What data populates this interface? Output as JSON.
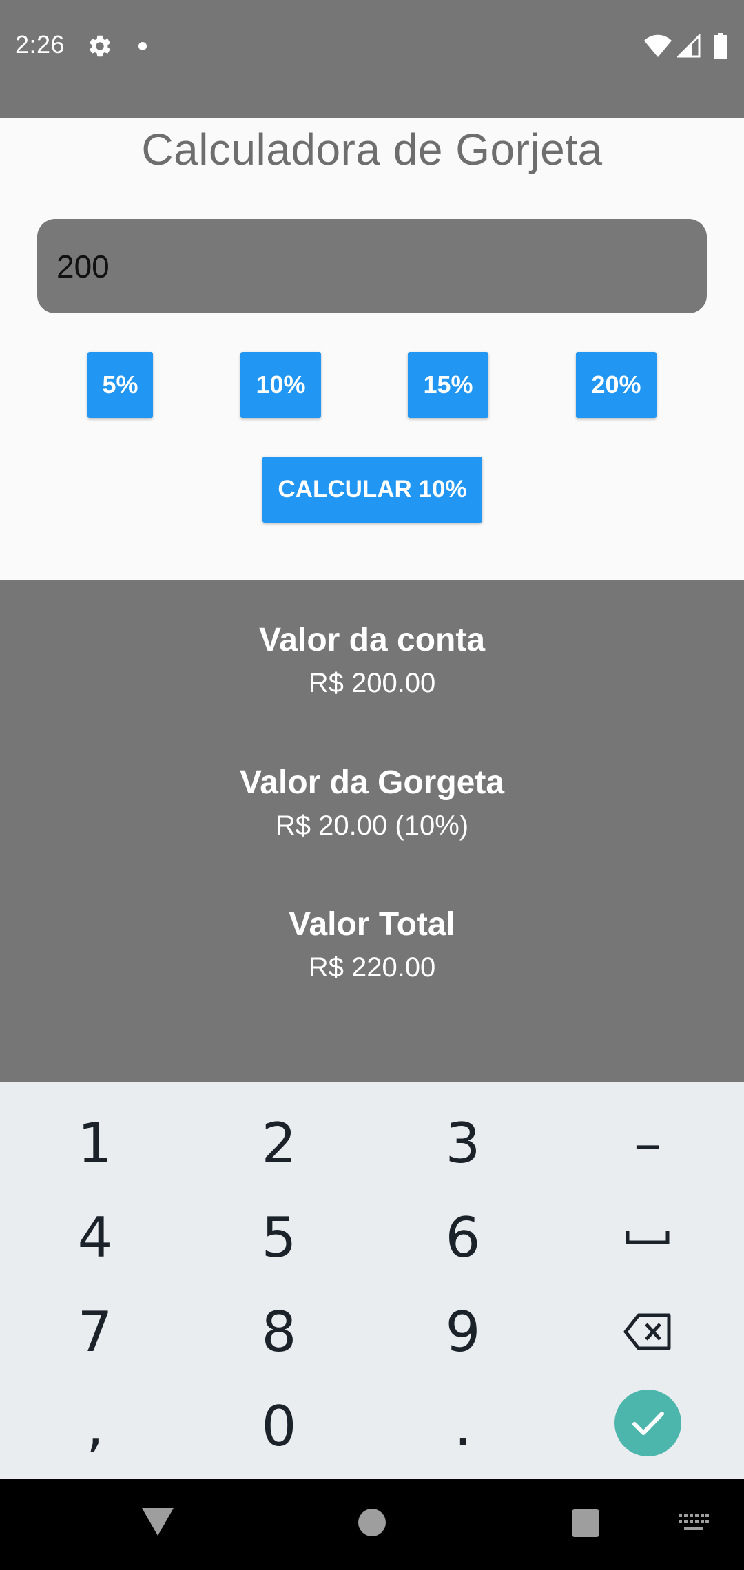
{
  "status_bar": {
    "time": "2:26",
    "icons": [
      "gear-icon",
      "notification-dot-icon",
      "wifi-icon",
      "signal-icon",
      "battery-icon"
    ]
  },
  "app": {
    "title": "Calculadora de Gorjeta",
    "bill_input": {
      "value": "200",
      "placeholder": ""
    },
    "percent_buttons": [
      "5%",
      "10%",
      "15%",
      "20%"
    ],
    "calculate_label": "CALCULAR 10%"
  },
  "results": {
    "bill_label": "Valor da conta",
    "bill_value": "R$ 200.00",
    "tip_label": "Valor da Gorgeta",
    "tip_value": "R$ 20.00 (10%)",
    "total_label": "Valor Total",
    "total_value": "R$ 220.00"
  },
  "keyboard": {
    "rows": [
      [
        "1",
        "2",
        "3",
        "–"
      ],
      [
        "4",
        "5",
        "6",
        "space-icon"
      ],
      [
        "7",
        "8",
        "9",
        "backspace-icon"
      ],
      [
        ",",
        "0",
        ".",
        "check-icon"
      ]
    ]
  },
  "nav_bar": {
    "icons": [
      "back-icon",
      "home-icon",
      "recents-icon",
      "keyboard-switch-icon"
    ]
  },
  "colors": {
    "status_bar": "#767676",
    "accent_button": "#2196f3",
    "results_bg": "#767676",
    "keyboard_bg": "#e9edf0",
    "done_key": "#4db6ac"
  }
}
